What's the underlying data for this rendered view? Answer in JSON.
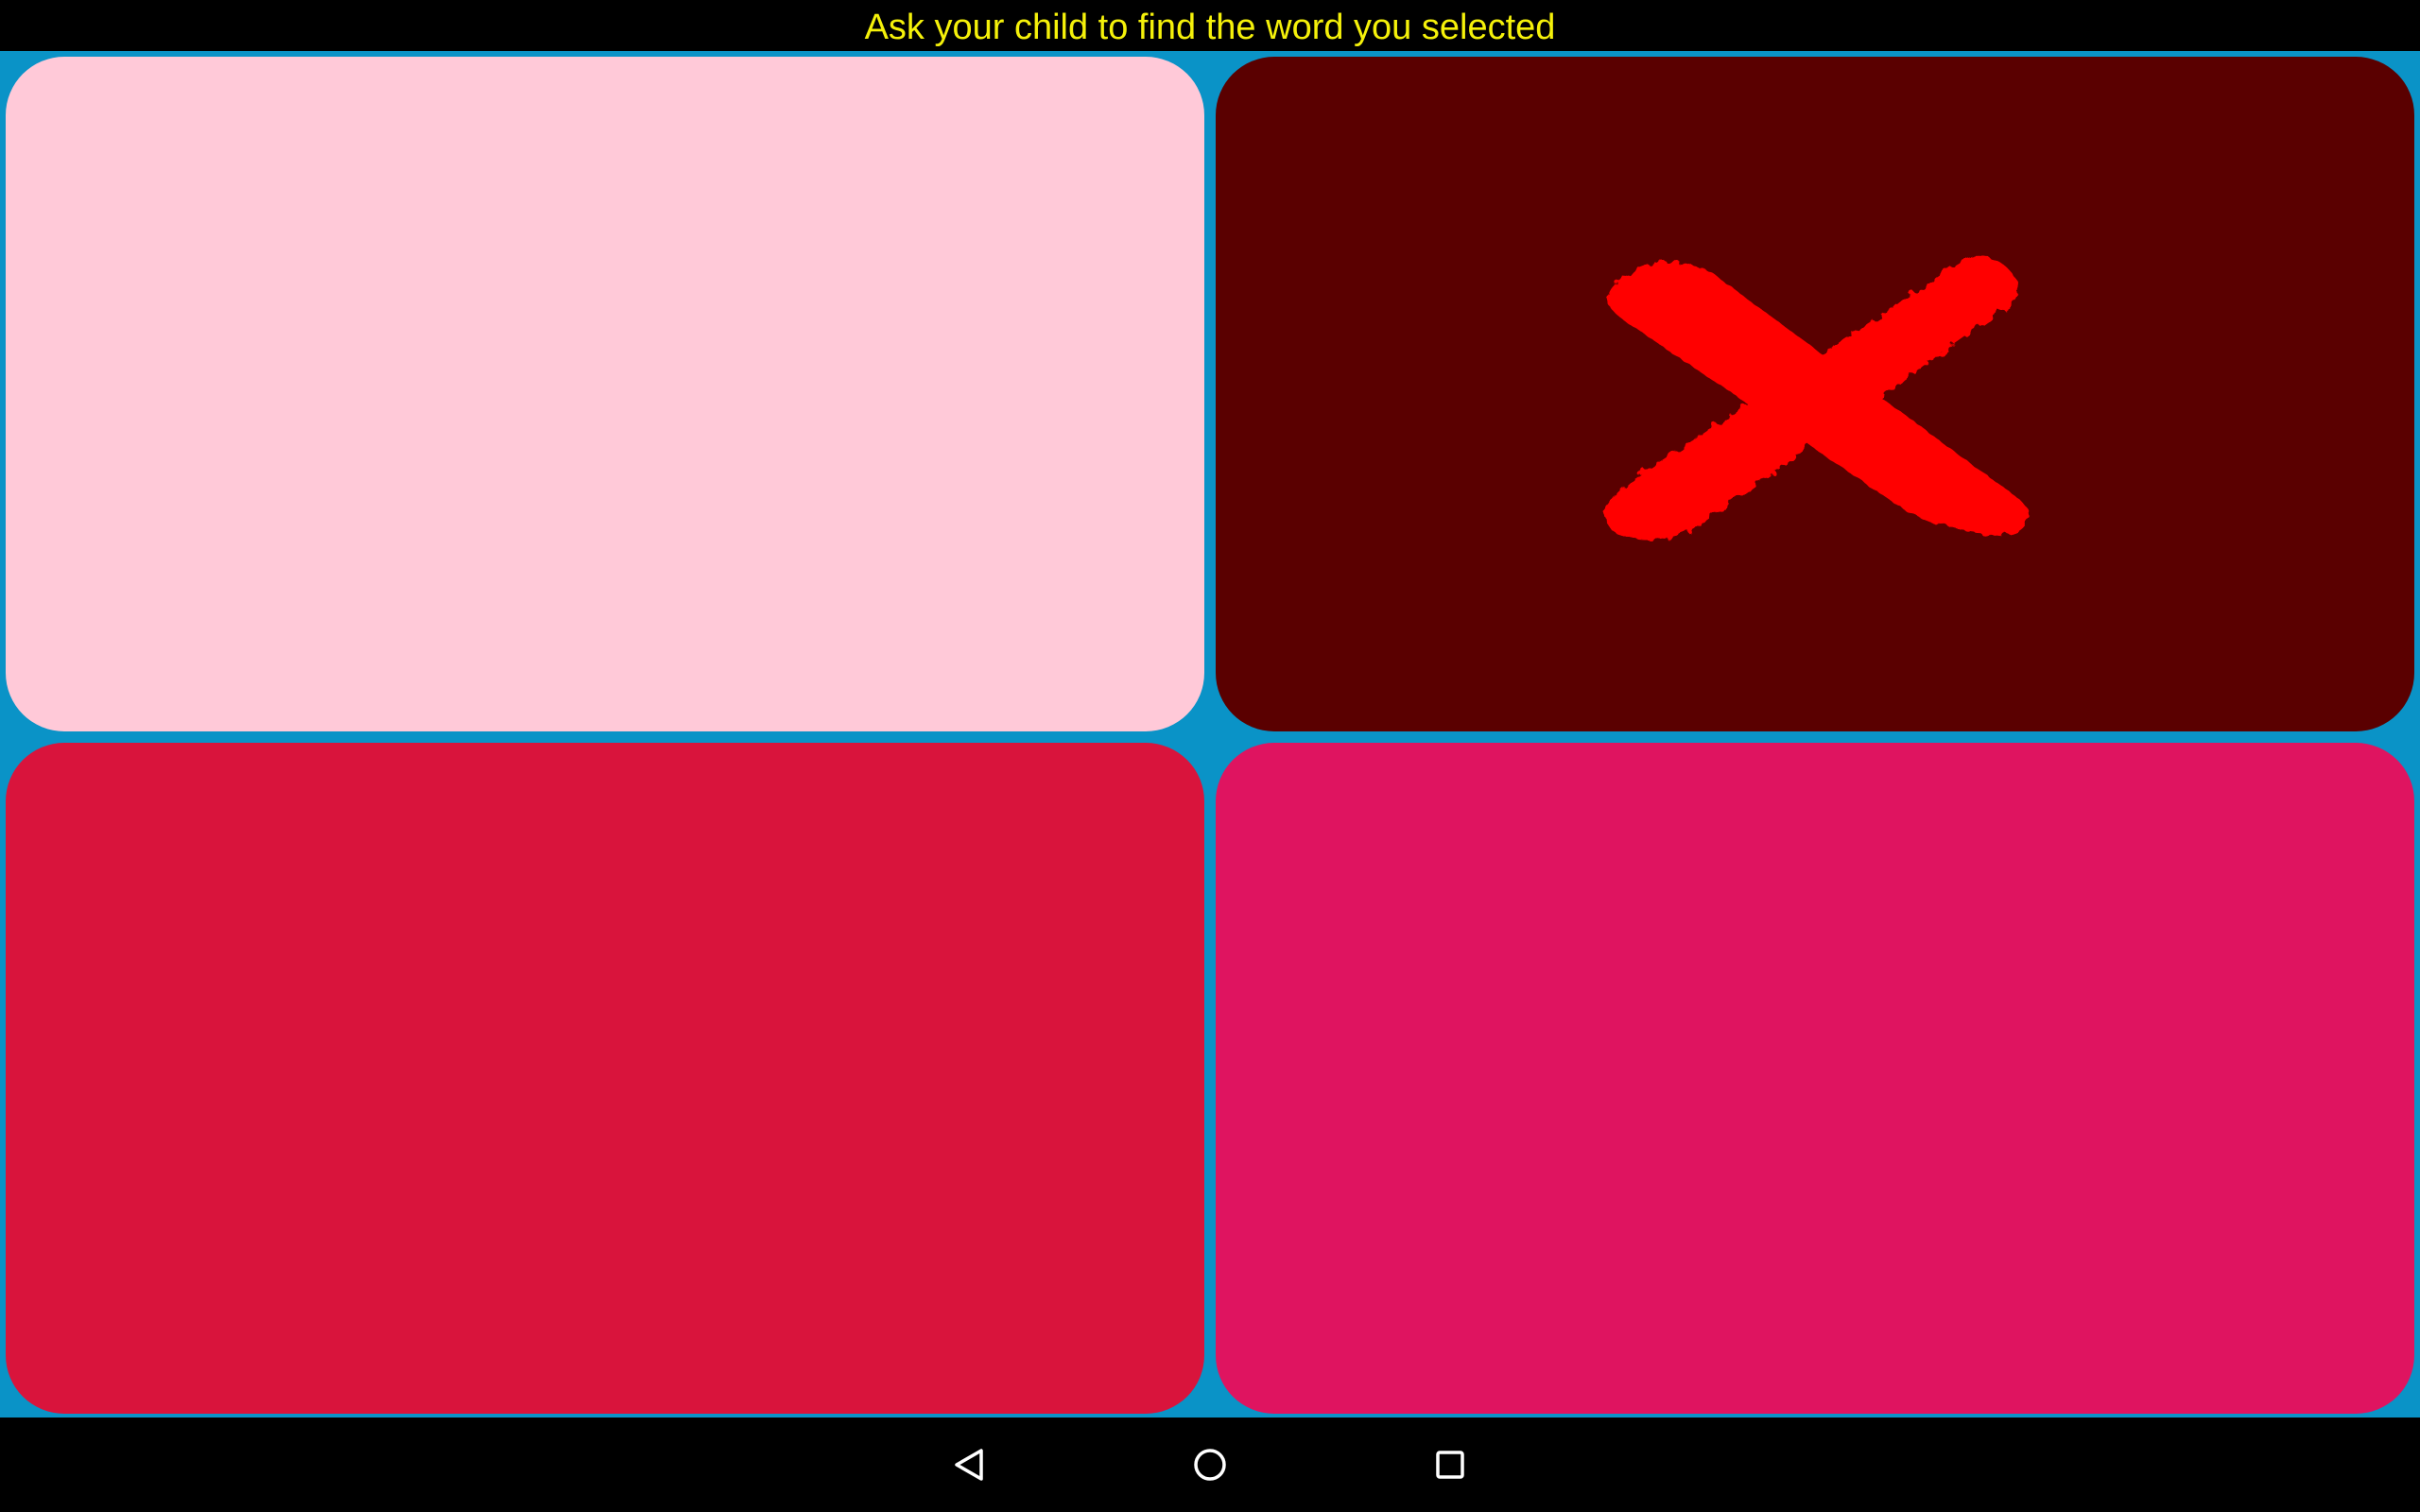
{
  "header": {
    "prompt_text": "Ask your child to find the word you selected",
    "text_color": "#f5f10a"
  },
  "board": {
    "background_color": "#0a93c7",
    "cards": [
      {
        "color": "#ffc9d8",
        "state": "unselected",
        "mark": ""
      },
      {
        "color": "#5a0000",
        "state": "wrong",
        "mark": "red-x-icon"
      },
      {
        "color": "#d9143c",
        "state": "unselected",
        "mark": ""
      },
      {
        "color": "#df1460",
        "state": "unselected",
        "mark": ""
      }
    ]
  },
  "navbar": {
    "buttons": [
      {
        "icon": "back-triangle-icon"
      },
      {
        "icon": "home-circle-icon"
      },
      {
        "icon": "recents-square-icon"
      }
    ]
  }
}
